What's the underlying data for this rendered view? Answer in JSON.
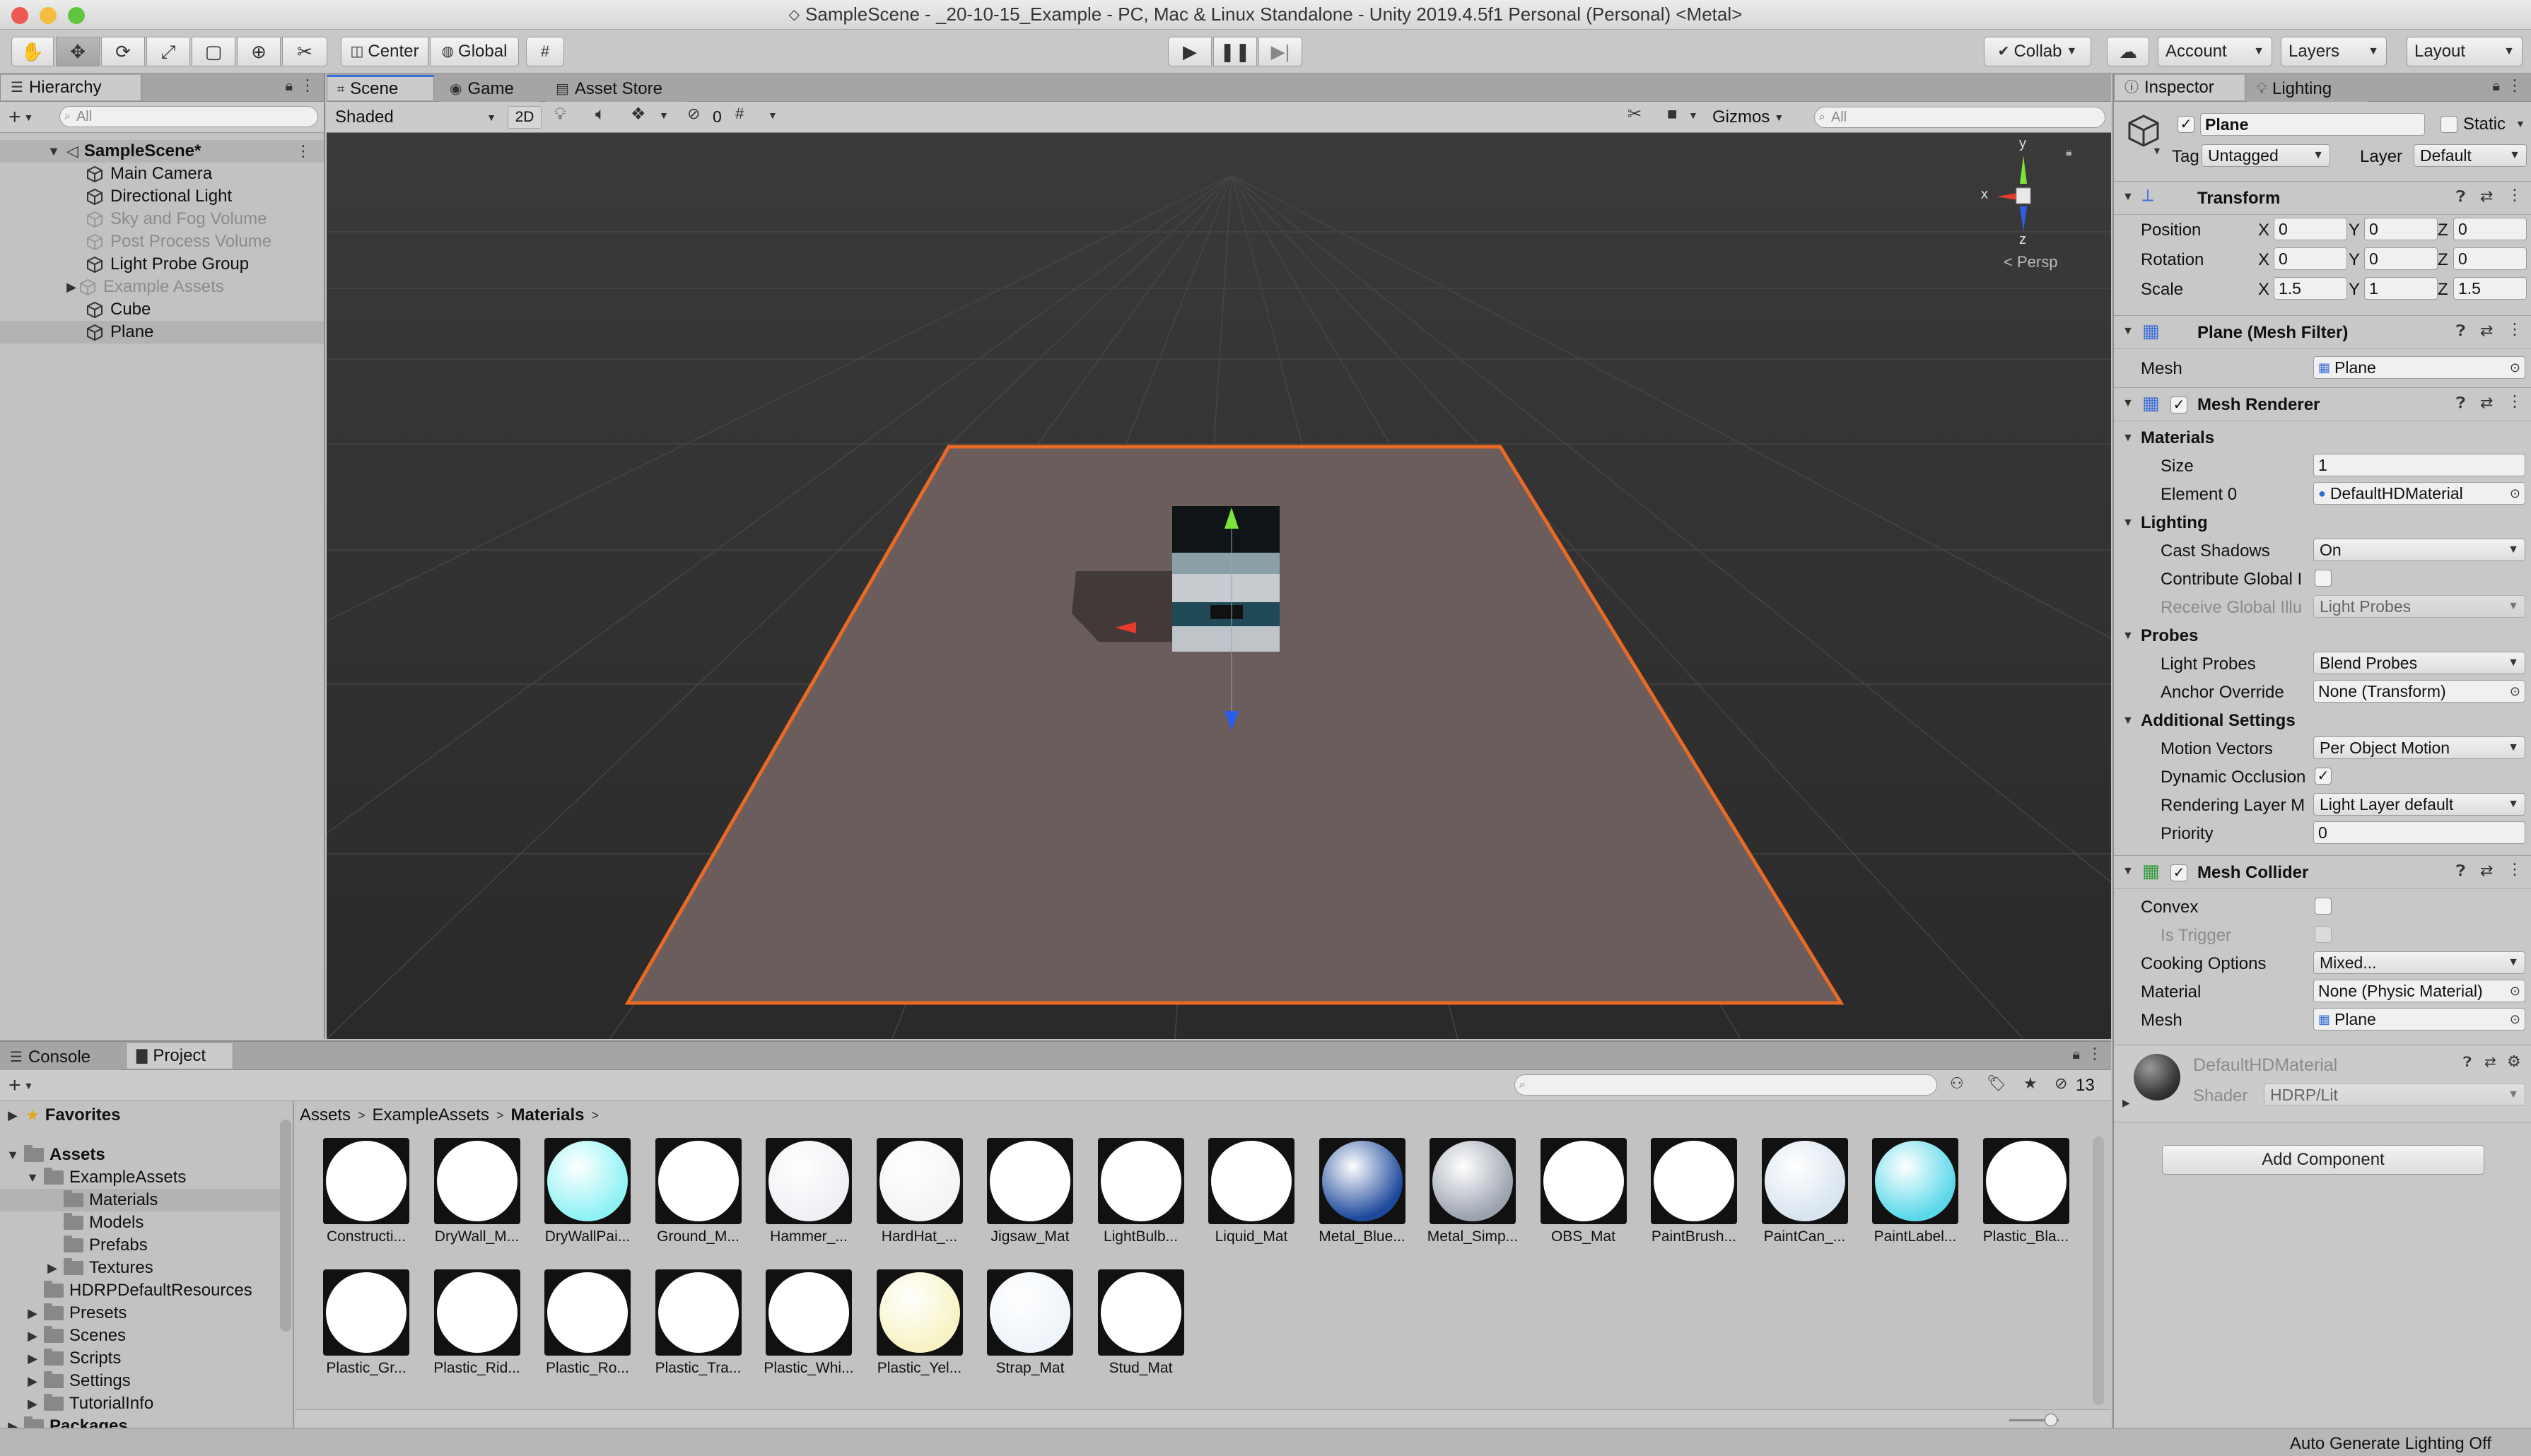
{
  "window": {
    "title": "SampleScene - _20-10-15_Example - PC, Mac & Linux Standalone - Unity 2019.4.5f1 Personal (Personal) <Metal>"
  },
  "toolbar": {
    "pivot_label": "Center",
    "space_label": "Global",
    "collab_label": "Collab",
    "account_label": "Account",
    "layers_label": "Layers",
    "layout_label": "Layout"
  },
  "hierarchy": {
    "tab_label": "Hierarchy",
    "search_placeholder": "All",
    "scene_name": "SampleScene*",
    "items": [
      {
        "label": "Main Camera",
        "dim": false
      },
      {
        "label": "Directional Light",
        "dim": false
      },
      {
        "label": "Sky and Fog Volume",
        "dim": true
      },
      {
        "label": "Post Process Volume",
        "dim": true
      },
      {
        "label": "Light Probe Group",
        "dim": false
      },
      {
        "label": "Example Assets",
        "dim": true
      },
      {
        "label": "Cube",
        "dim": false
      },
      {
        "label": "Plane",
        "dim": false
      }
    ]
  },
  "scene": {
    "tabs": [
      "Scene",
      "Game",
      "Asset Store"
    ],
    "shading_mode": "Shaded",
    "mode_2d": "2D",
    "hidden_count": "0",
    "gizmos_label": "Gizmos",
    "search_placeholder": "All",
    "axis_y": "y",
    "axis_x": "x",
    "axis_z": "z",
    "projection_label": "< Persp"
  },
  "inspector": {
    "tabs": [
      "Inspector",
      "Lighting"
    ],
    "object_name": "Plane",
    "static_label": "Static",
    "tag_label": "Tag",
    "tag_value": "Untagged",
    "layer_label": "Layer",
    "layer_value": "Default",
    "transform": {
      "title": "Transform",
      "rows": [
        {
          "label": "Position",
          "x": "0",
          "y": "0",
          "z": "0"
        },
        {
          "label": "Rotation",
          "x": "0",
          "y": "0",
          "z": "0"
        },
        {
          "label": "Scale",
          "x": "1.5",
          "y": "1",
          "z": "1.5"
        }
      ],
      "x_label": "X",
      "y_label": "Y",
      "z_label": "Z"
    },
    "mesh_filter": {
      "title": "Plane (Mesh Filter)",
      "mesh_label": "Mesh",
      "mesh_value": "Plane"
    },
    "mesh_renderer": {
      "title": "Mesh Renderer",
      "materials_label": "Materials",
      "size_label": "Size",
      "size_value": "1",
      "element_label": "Element 0",
      "element_value": "DefaultHDMaterial",
      "lighting_label": "Lighting",
      "cast_shadows_label": "Cast Shadows",
      "cast_shadows_value": "On",
      "contribute_gi_label": "Contribute Global I",
      "receive_gi_label": "Receive Global Illu",
      "receive_gi_value": "Light Probes",
      "probes_label": "Probes",
      "light_probes_label": "Light Probes",
      "light_probes_value": "Blend Probes",
      "anchor_label": "Anchor Override",
      "anchor_value": "None (Transform)",
      "additional_label": "Additional Settings",
      "motion_vectors_label": "Motion Vectors",
      "motion_vectors_value": "Per Object Motion",
      "dynamic_occlusion_label": "Dynamic Occlusion",
      "rendering_layer_label": "Rendering Layer M",
      "rendering_layer_value": "Light Layer default",
      "priority_label": "Priority",
      "priority_value": "0"
    },
    "mesh_collider": {
      "title": "Mesh Collider",
      "convex_label": "Convex",
      "is_trigger_label": "Is Trigger",
      "cooking_label": "Cooking Options",
      "cooking_value": "Mixed...",
      "material_label": "Material",
      "material_value": "None (Physic Material)",
      "mesh_label": "Mesh",
      "mesh_value": "Plane"
    },
    "material": {
      "name": "DefaultHDMaterial",
      "shader_label": "Shader",
      "shader_value": "HDRP/Lit"
    },
    "add_component_label": "Add Component"
  },
  "project": {
    "tabs": [
      "Console",
      "Project"
    ],
    "hidden_count": "13",
    "breadcrumb": [
      "Assets",
      "ExampleAssets",
      "Materials"
    ],
    "favorites_label": "Favorites",
    "tree": [
      {
        "label": "Assets",
        "level": 0,
        "bold": true
      },
      {
        "label": "ExampleAssets",
        "level": 1,
        "bold": false
      },
      {
        "label": "Materials",
        "level": 2,
        "bold": false
      },
      {
        "label": "Models",
        "level": 2,
        "bold": false
      },
      {
        "label": "Prefabs",
        "level": 2,
        "bold": false
      },
      {
        "label": "Textures",
        "level": 2,
        "bold": false
      },
      {
        "label": "HDRPDefaultResources",
        "level": 1,
        "bold": false
      },
      {
        "label": "Presets",
        "level": 1,
        "bold": false
      },
      {
        "label": "Scenes",
        "level": 1,
        "bold": false
      },
      {
        "label": "Scripts",
        "level": 1,
        "bold": false
      },
      {
        "label": "Settings",
        "level": 1,
        "bold": false
      },
      {
        "label": "TutorialInfo",
        "level": 1,
        "bold": false
      },
      {
        "label": "Packages",
        "level": 0,
        "bold": true
      }
    ],
    "assets": [
      {
        "label": "Constructi...",
        "tint": "#ffffff"
      },
      {
        "label": "DryWall_M...",
        "tint": "#ffffff"
      },
      {
        "label": "DryWallPai...",
        "tint": "#8ff2f4"
      },
      {
        "label": "Ground_M...",
        "tint": "#ffffff"
      },
      {
        "label": "Hammer_...",
        "tint": "#eef0f4"
      },
      {
        "label": "HardHat_...",
        "tint": "#f4f4f4"
      },
      {
        "label": "Jigsaw_Mat",
        "tint": "#ffffff"
      },
      {
        "label": "LightBulb...",
        "tint": "#ffffff"
      },
      {
        "label": "Liquid_Mat",
        "tint": "#ffffff"
      },
      {
        "label": "Metal_Blue...",
        "tint": "#1f4a9c"
      },
      {
        "label": "Metal_Simp...",
        "tint": "#9ca3b0"
      },
      {
        "label": "OBS_Mat",
        "tint": "#ffffff"
      },
      {
        "label": "PaintBrush...",
        "tint": "#ffffff"
      },
      {
        "label": "PaintCan_...",
        "tint": "#d8e4ef"
      },
      {
        "label": "PaintLabel...",
        "tint": "#5ad8ea"
      },
      {
        "label": "Plastic_Bla...",
        "tint": "#ffffff"
      },
      {
        "label": "Plastic_Gr...",
        "tint": "#ffffff"
      },
      {
        "label": "Plastic_Rid...",
        "tint": "#ffffff"
      },
      {
        "label": "Plastic_Ro...",
        "tint": "#ffffff"
      },
      {
        "label": "Plastic_Tra...",
        "tint": "#ffffff"
      },
      {
        "label": "Plastic_Whi...",
        "tint": "#ffffff"
      },
      {
        "label": "Plastic_Yel...",
        "tint": "#f7f3c4"
      },
      {
        "label": "Strap_Mat",
        "tint": "#eef4fa"
      },
      {
        "label": "Stud_Mat",
        "tint": "#ffffff"
      }
    ]
  },
  "status": {
    "text": "Auto Generate Lighting Off"
  }
}
